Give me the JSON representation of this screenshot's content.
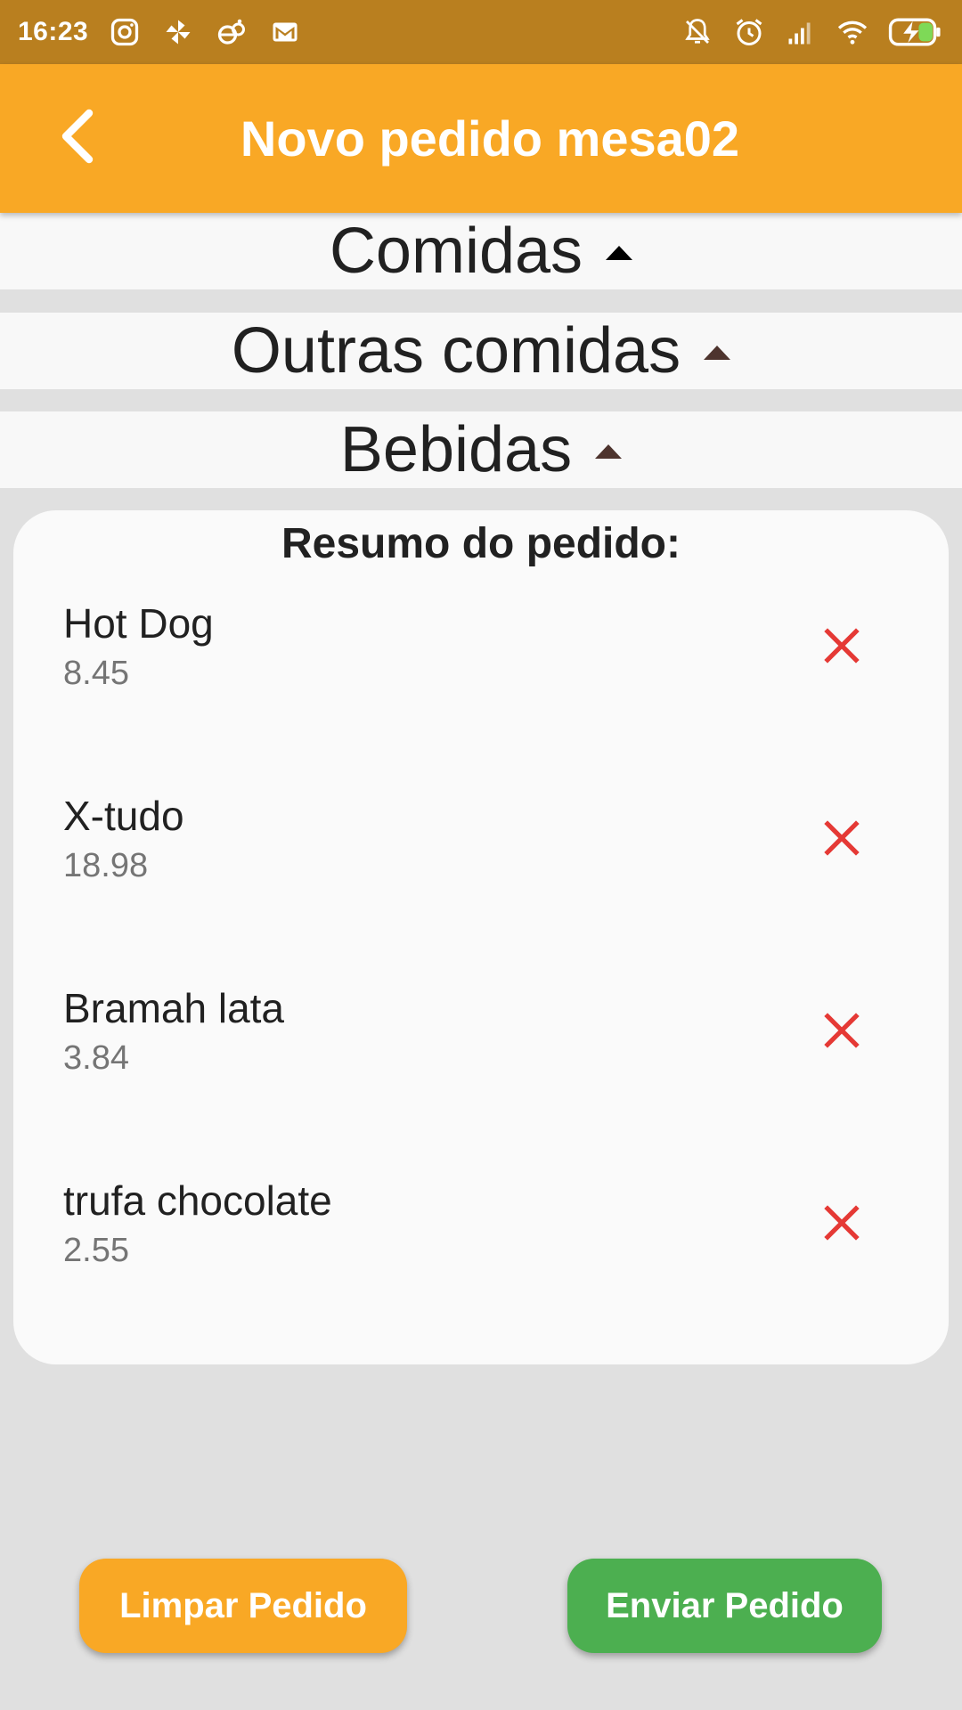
{
  "status_bar": {
    "time": "16:23",
    "left_icons": [
      "instagram-icon",
      "pinwheel-icon",
      "app-icon",
      "gmail-icon"
    ],
    "right_icons": [
      "notifications-off-icon",
      "alarm-icon",
      "signal-icon",
      "wifi-icon",
      "battery-charging-icon"
    ]
  },
  "app_bar": {
    "title": "Novo pedido mesa02",
    "back_icon": "chevron-left-icon"
  },
  "categories": [
    {
      "label": "Comidas"
    },
    {
      "label": "Outras comidas"
    },
    {
      "label": "Bebidas"
    }
  ],
  "summary": {
    "title": "Resumo do pedido:",
    "items": [
      {
        "name": "Hot Dog",
        "price": "8.45"
      },
      {
        "name": "X-tudo",
        "price": "18.98"
      },
      {
        "name": "Bramah lata",
        "price": "3.84"
      },
      {
        "name": "trufa chocolate",
        "price": "2.55"
      }
    ]
  },
  "actions": {
    "clear_label": "Limpar Pedido",
    "send_label": "Enviar Pedido"
  },
  "colors": {
    "status_bar": "#b97f1f",
    "app_bar": "#f9a825",
    "clear_button": "#f9a825",
    "send_button": "#4caf50",
    "remove_icon": "#e53935"
  }
}
